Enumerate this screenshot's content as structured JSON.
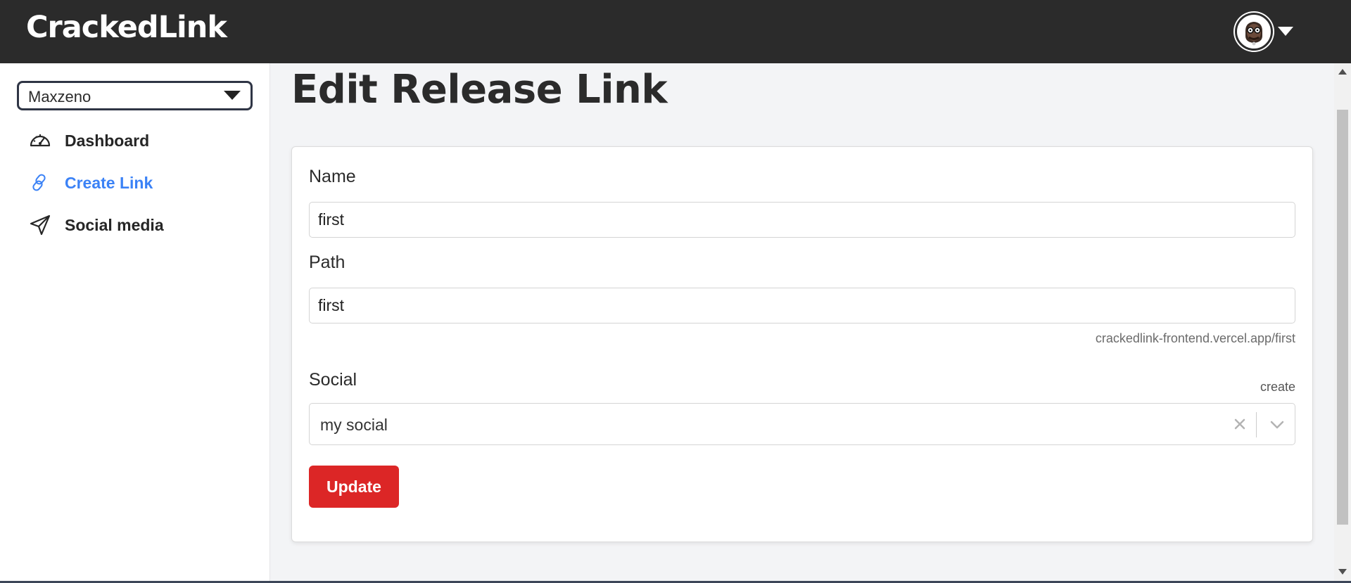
{
  "header": {
    "brand": "CrackedLink",
    "avatar_icon": "avatar-icon",
    "menu_icon": "caret-down-icon"
  },
  "sidebar": {
    "project_select": {
      "value": "Maxzeno"
    },
    "items": [
      {
        "label": "Dashboard",
        "icon": "gauge-icon",
        "active": false
      },
      {
        "label": "Create Link",
        "icon": "link-icon",
        "active": true
      },
      {
        "label": "Social media",
        "icon": "send-icon",
        "active": false
      }
    ]
  },
  "main": {
    "title": "Edit Release Link",
    "form": {
      "name_label": "Name",
      "name_value": "first",
      "path_label": "Path",
      "path_value": "first",
      "path_hint": "crackedlink-frontend.vercel.app/first",
      "social_label": "Social",
      "social_create": "create",
      "social_value": "my social",
      "update_label": "Update"
    }
  },
  "colors": {
    "topbar": "#2b2b2b",
    "accent": "#3b82f6",
    "button": "#dc2626"
  }
}
